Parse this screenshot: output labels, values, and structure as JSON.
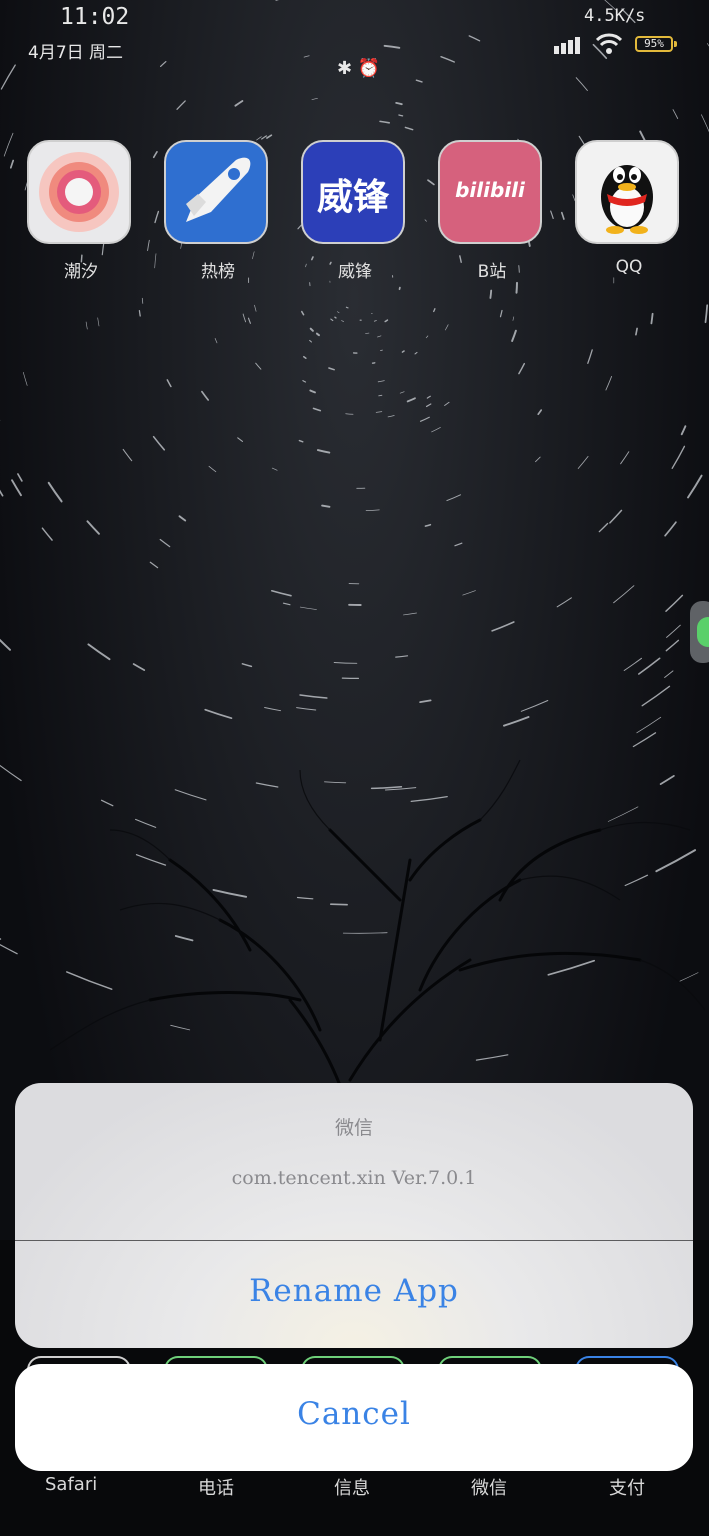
{
  "status_bar": {
    "time": "11:02",
    "date": "4月7日  周二",
    "middle_icons": "✱ ⏰",
    "net_speed": "4.5K/s",
    "battery": "95%",
    "battery_level": 0.95
  },
  "apps": [
    {
      "label": "潮汐",
      "icon": "tide-app-icon"
    },
    {
      "label": "热榜",
      "icon": "rocket-app-icon"
    },
    {
      "label": "威锋",
      "icon_text": "威锋",
      "icon": "weifeng-app-icon"
    },
    {
      "label": "B站",
      "icon_text": "bilibili",
      "icon": "bilibili-app-icon"
    },
    {
      "label": "QQ",
      "icon": "qq-penguin-app-icon"
    }
  ],
  "dock": {
    "labels": [
      "Safari",
      "电话",
      "信息",
      "微信",
      "支付"
    ]
  },
  "action_sheet": {
    "title": "微信",
    "subtitle": "com.tencent.xin Ver.7.0.1",
    "action": "Rename App",
    "cancel": "Cancel",
    "accent_color": "#3a83e5"
  }
}
